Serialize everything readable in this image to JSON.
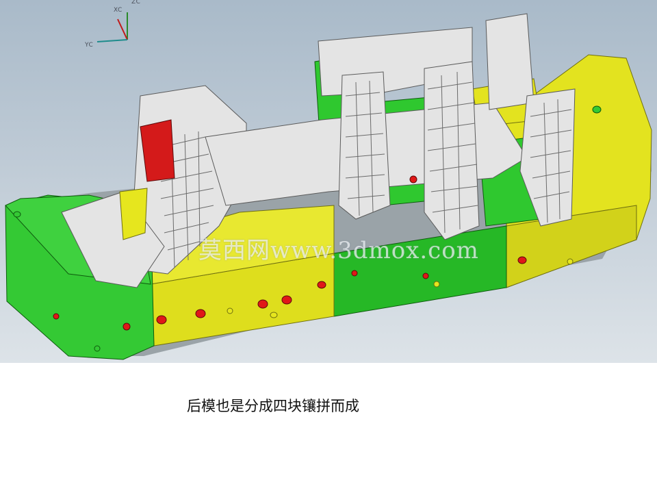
{
  "viewport": {
    "axes": {
      "x_label": "XC",
      "y_label": "YC",
      "z_label": "ZC"
    },
    "watermark": "莫西网www.3dmox.com",
    "colors": {
      "background_top": "#a9bac9",
      "insert_green": "#2fc82f",
      "insert_yellow": "#e6e61e",
      "core_white": "#e4e4e4",
      "hole_red": "#e01818"
    }
  },
  "caption": "后模也是分成四块镶拼而成"
}
